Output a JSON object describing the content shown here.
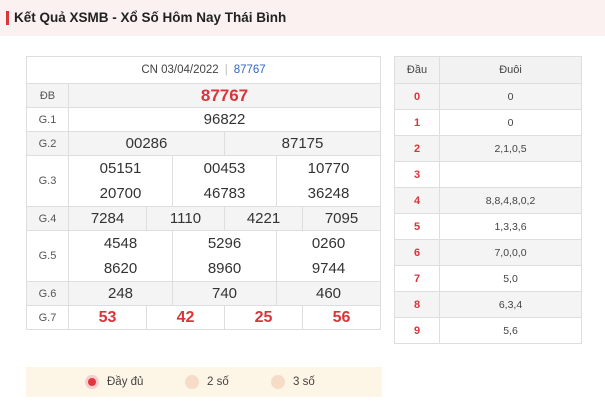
{
  "header": {
    "title": "Kết Quả XSMB - Xổ Số Hôm Nay Thái Bình"
  },
  "results": {
    "date": "CN 03/04/2022",
    "separator": "|",
    "code": "87767",
    "rows": [
      {
        "label": "ĐB",
        "values": [
          "87767"
        ]
      },
      {
        "label": "G.1",
        "values": [
          "96822"
        ]
      },
      {
        "label": "G.2",
        "values": [
          "00286",
          "87175"
        ]
      },
      {
        "label": "G.3",
        "values": [
          "05151",
          "00453",
          "10770",
          "20700",
          "46783",
          "36248"
        ]
      },
      {
        "label": "G.4",
        "values": [
          "7284",
          "1110",
          "4221",
          "7095"
        ]
      },
      {
        "label": "G.5",
        "values": [
          "4548",
          "5296",
          "0260",
          "8620",
          "8960",
          "9744"
        ]
      },
      {
        "label": "G.6",
        "values": [
          "248",
          "740",
          "460"
        ]
      },
      {
        "label": "G.7",
        "values": [
          "53",
          "42",
          "25",
          "56"
        ]
      }
    ]
  },
  "options": [
    {
      "label": "Đầy đủ",
      "selected": true
    },
    {
      "label": "2 số",
      "selected": false
    },
    {
      "label": "3 số",
      "selected": false
    }
  ],
  "loto": {
    "headers": [
      "Đầu",
      "Đuôi"
    ],
    "rows": [
      {
        "head": "0",
        "tail": "0"
      },
      {
        "head": "1",
        "tail": "0"
      },
      {
        "head": "2",
        "tail": "2,1,0,5"
      },
      {
        "head": "3",
        "tail": ""
      },
      {
        "head": "4",
        "tail": "8,8,4,8,0,2"
      },
      {
        "head": "5",
        "tail": "1,3,3,6"
      },
      {
        "head": "6",
        "tail": "7,0,0,0"
      },
      {
        "head": "7",
        "tail": "5,0"
      },
      {
        "head": "8",
        "tail": "6,3,4"
      },
      {
        "head": "9",
        "tail": "5,6"
      }
    ]
  },
  "colors": {
    "accent": "#d9353b",
    "code": "#2f67c4",
    "header_bg": "#fbf1f1",
    "options_bg": "#fdf5e6"
  }
}
